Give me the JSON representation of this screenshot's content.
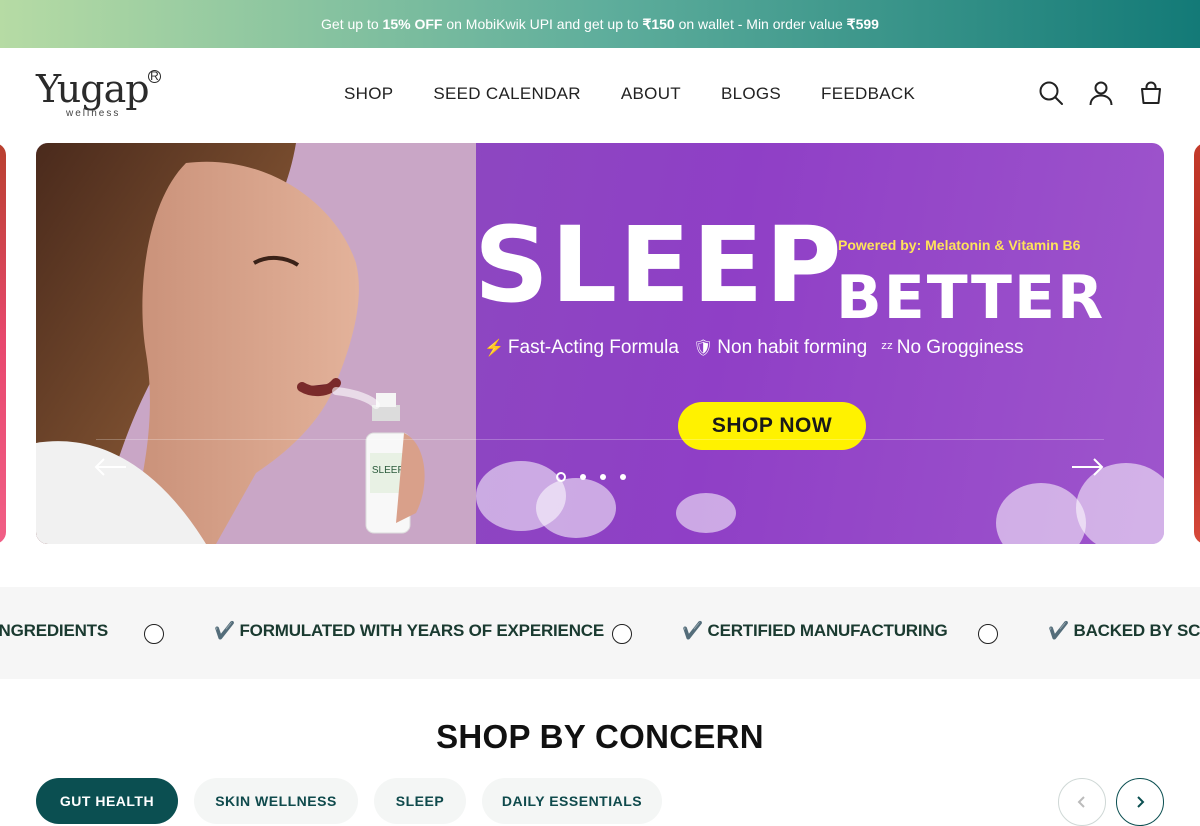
{
  "announcement": {
    "pre": "Get up to ",
    "bold1": "15% OFF",
    "mid": " on MobiKwik UPI and get up to ",
    "bold2": "₹150",
    "mid2": " on wallet - Min order value ",
    "bold3": "₹599"
  },
  "header": {
    "logo_word": "Yugap",
    "logo_reg": "R",
    "logo_tag": "wellness",
    "nav": [
      "SHOP",
      "SEED CALENDAR",
      "ABOUT",
      "BLOGS",
      "FEEDBACK"
    ],
    "icons": [
      "search-icon",
      "account-icon",
      "cart-icon"
    ]
  },
  "hero": {
    "headline_1": "SLEEP",
    "powered": "Powered by: Melatonin & Vitamin B6",
    "headline_2": "BETTER",
    "features": [
      {
        "icon": "lightning-icon",
        "text": "Fast-Acting Formula"
      },
      {
        "icon": "shield-check-icon",
        "text": "Non habit forming"
      },
      {
        "icon": "zzz-icon",
        "text": "No Grogginess"
      }
    ],
    "cta": "SHOP NOW",
    "slide_count": 4,
    "active_slide": 1,
    "accent_color": "#8f3fc6",
    "cta_color": "#fff200"
  },
  "marquee": {
    "items": [
      "INGREDIENTS",
      "✔️ FORMULATED WITH YEARS OF EXPERIENCE",
      "✔️ CERTIFIED MANUFACTURING",
      "✔️ BACKED BY SCIE"
    ]
  },
  "concern": {
    "title": "SHOP BY CONCERN",
    "tabs": [
      "GUT HEALTH",
      "SKIN WELLNESS",
      "SLEEP",
      "DAILY ESSENTIALS"
    ],
    "active_tab": 0,
    "brand_color": "#0b4f51"
  }
}
